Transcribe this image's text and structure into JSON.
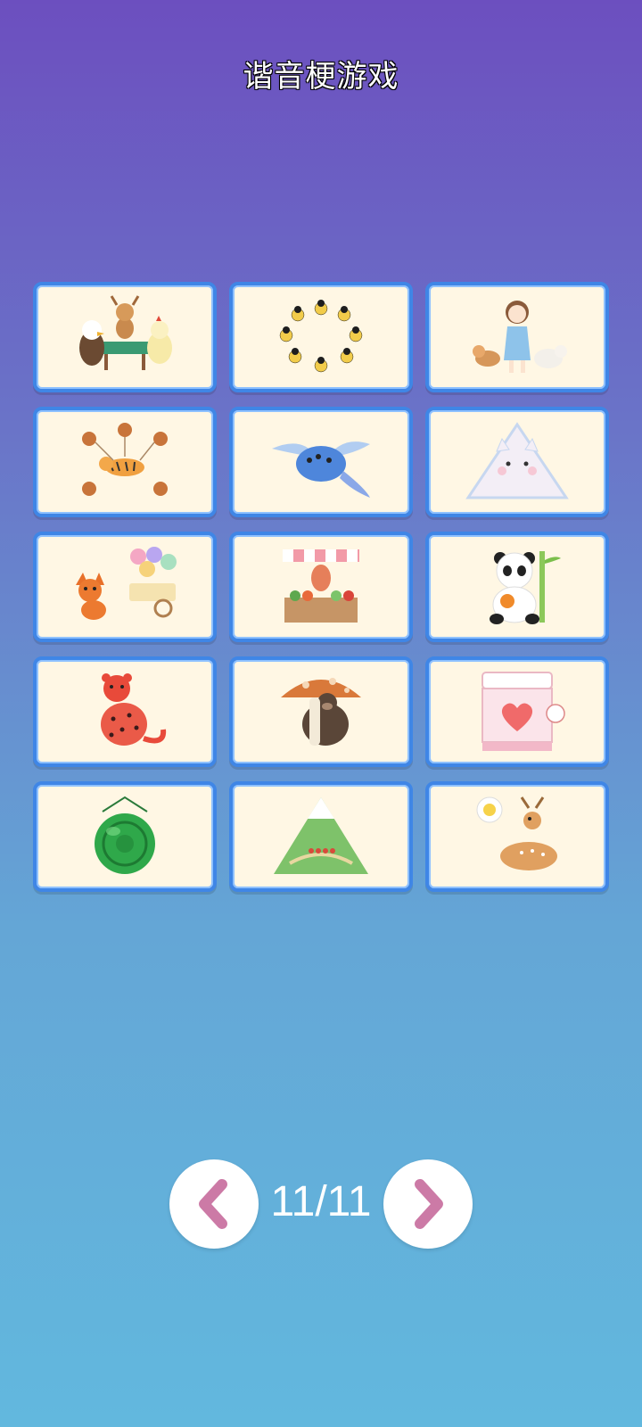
{
  "title": "谐音梗游戏",
  "cards": [
    {
      "icon": "animals-card-game-icon"
    },
    {
      "icon": "people-circle-icon"
    },
    {
      "icon": "girl-with-pets-icon"
    },
    {
      "icon": "squirrels-and-tiger-icon"
    },
    {
      "icon": "flying-fish-icon"
    },
    {
      "icon": "triangle-cat-icon"
    },
    {
      "icon": "fox-with-lollipop-cart-icon"
    },
    {
      "icon": "squid-vegetable-stall-icon"
    },
    {
      "icon": "panda-with-bamboo-icon"
    },
    {
      "icon": "red-leopard-icon"
    },
    {
      "icon": "gorilla-with-mushroom-icon"
    },
    {
      "icon": "heart-claw-machine-icon"
    },
    {
      "icon": "green-gong-icon"
    },
    {
      "icon": "mountain-icon"
    },
    {
      "icon": "deer-thinking-chick-icon"
    }
  ],
  "pagination": {
    "label": "11/11",
    "prev_icon": "chevron-left-icon",
    "next_icon": "chevron-right-icon"
  },
  "colors": {
    "card_border": "#3f86e6",
    "card_bg": "#fff7e4",
    "chevron": "#cc7aa6"
  }
}
